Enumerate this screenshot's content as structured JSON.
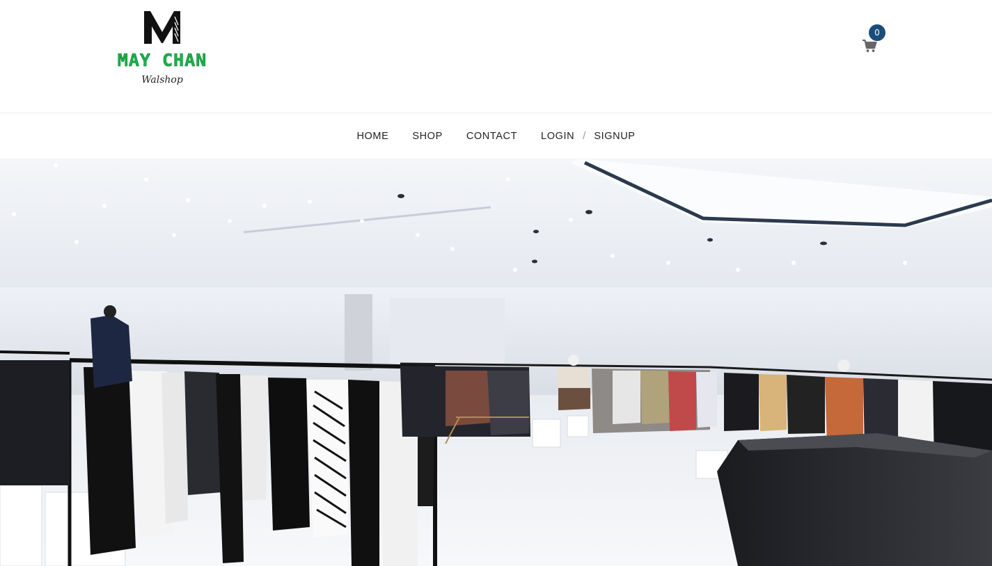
{
  "brand": {
    "logo_letter": "M",
    "logo_name": "MAY CHAN",
    "logo_tagline": "Walshop",
    "logo_name_color": "#19b34a"
  },
  "cart": {
    "count": "0",
    "icon": "shopping-cart-icon",
    "badge_color": "#1b4d7a"
  },
  "nav": {
    "home": "HOME",
    "shop": "SHOP",
    "contact": "CONTACT",
    "login": "LOGIN",
    "separator": "/",
    "signup": "SIGNUP"
  },
  "hero": {
    "image": "clothing-store-interior-photo"
  }
}
